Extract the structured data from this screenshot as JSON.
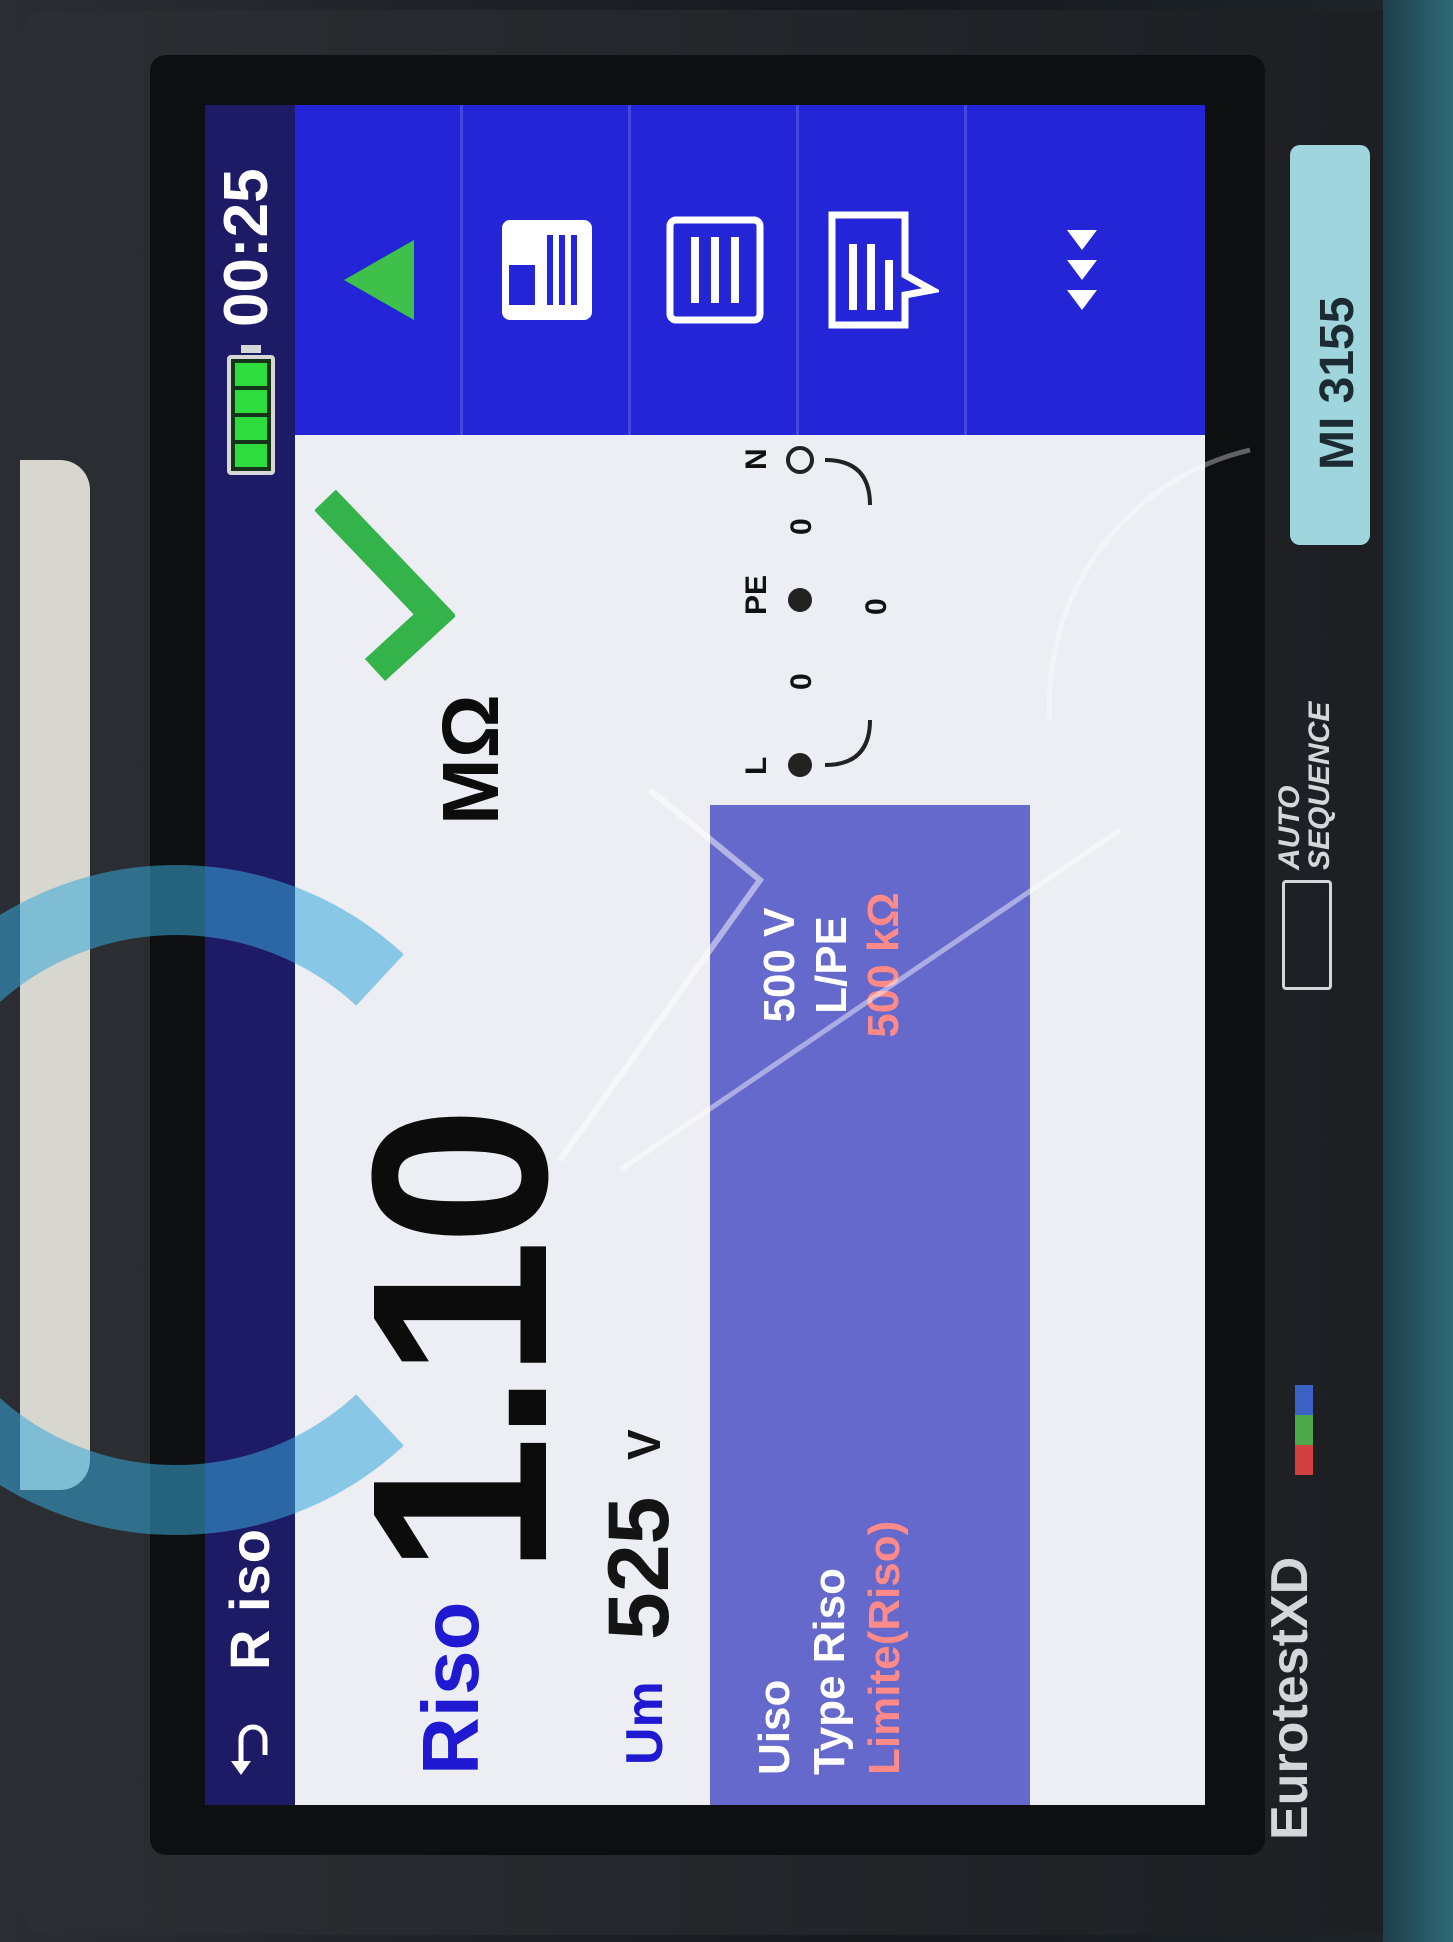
{
  "status_bar": {
    "title": "R iso",
    "clock": "00:25",
    "battery_cells": 4
  },
  "result": {
    "name": "Riso",
    "value": "1.10",
    "unit": "MΩ",
    "status": "pass"
  },
  "measured": {
    "label": "Um",
    "value": "525",
    "unit": "V"
  },
  "parameters": [
    {
      "label": "Uiso",
      "value": "500 V"
    },
    {
      "label": "Type Riso",
      "value": "L/PE"
    },
    {
      "label": "Limite(Riso)",
      "value": "500 kΩ"
    }
  ],
  "terminals": {
    "labels": [
      "L",
      "PE",
      "N"
    ],
    "values": [
      "0",
      "0",
      "0"
    ]
  },
  "buttons": {
    "start": "play-icon",
    "save": "save-icon",
    "memory": "memory-list-icon",
    "comment": "comment-icon",
    "more": "more-arrows-icon"
  },
  "device": {
    "brand": "EurotestXD",
    "model": "MI 3155",
    "sequence_label_line1": "AUTO",
    "sequence_label_line2": "SEQUENCE"
  },
  "colors": {
    "title_bar": "#1d1a66",
    "accent_blue": "#1f1ad1",
    "button_column": "#1e1fcc",
    "params_panel": "#6569cc",
    "pass_green": "#34b34a",
    "limit_text": "#ff8a88"
  }
}
